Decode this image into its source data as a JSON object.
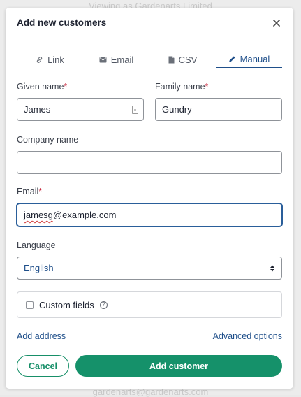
{
  "background": {
    "top_text": "Viewing as Gardenarts Limited",
    "bottom_text": "gardenarts@gardenarts.com"
  },
  "modal": {
    "title": "Add new customers",
    "close_icon": "close-icon"
  },
  "tabs": [
    {
      "label": "Link",
      "icon": "link-icon",
      "active": false
    },
    {
      "label": "Email",
      "icon": "envelope-icon",
      "active": false
    },
    {
      "label": "CSV",
      "icon": "file-icon",
      "active": false
    },
    {
      "label": "Manual",
      "icon": "pencil-icon",
      "active": true
    }
  ],
  "form": {
    "given_name": {
      "label": "Given name",
      "required_mark": "*",
      "value": "James"
    },
    "family_name": {
      "label": "Family name",
      "required_mark": "*",
      "value": "Gundry"
    },
    "company_name": {
      "label": "Company name",
      "value": ""
    },
    "email": {
      "label": "Email",
      "required_mark": "*",
      "value": "jamesg@example.com",
      "misspelled_part": "jamesg"
    },
    "language": {
      "label": "Language",
      "value": "English"
    },
    "custom_fields": {
      "label": "Custom fields",
      "help": "?",
      "checked": false
    }
  },
  "links": {
    "add_address": "Add address",
    "advanced_options": "Advanced options"
  },
  "buttons": {
    "cancel": "Cancel",
    "add_customer": "Add customer"
  },
  "colors": {
    "accent_blue": "#1f4f8a",
    "primary_green": "#15916a",
    "required_red": "#c8243a"
  }
}
